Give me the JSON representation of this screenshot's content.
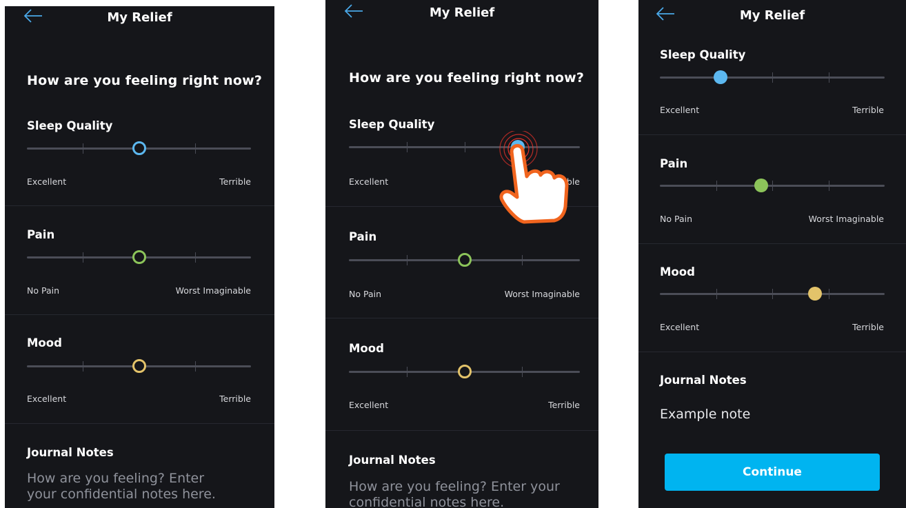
{
  "colors": {
    "background": "#15161a",
    "sleep_accent": "#5cb8f0",
    "pain_accent": "#8cc45a",
    "mood_accent": "#e3c36a",
    "continue_button": "#00b4f0",
    "tap_indicator": "#f0641e"
  },
  "icons": {
    "back": "arrow-left-icon",
    "tap": "tap-hand-icon"
  },
  "screens": [
    {
      "title": "My Relief",
      "question": "How are you feeling right now?",
      "sliders": [
        {
          "label": "Sleep Quality",
          "min_label": "Excellent",
          "max_label": "Terrible",
          "value_fraction": 0.5,
          "thumb_style": "outline"
        },
        {
          "label": "Pain",
          "min_label": "No Pain",
          "max_label": "Worst Imaginable",
          "value_fraction": 0.5,
          "thumb_style": "outline"
        },
        {
          "label": "Mood",
          "min_label": "Excellent",
          "max_label": "Terrible",
          "value_fraction": 0.5,
          "thumb_style": "outline"
        }
      ],
      "journal": {
        "label": "Journal Notes",
        "placeholder": "How are you feeling? Enter your confidential notes here.",
        "value": ""
      }
    },
    {
      "title": "My Relief",
      "question": "How are you feeling right now?",
      "sliders": [
        {
          "label": "Sleep Quality",
          "min_label": "Excellent",
          "max_label": "Terrible",
          "value_fraction": 0.73,
          "thumb_style": "filled"
        },
        {
          "label": "Pain",
          "min_label": "No Pain",
          "max_label": "Worst Imaginable",
          "value_fraction": 0.5,
          "thumb_style": "outline"
        },
        {
          "label": "Mood",
          "min_label": "Excellent",
          "max_label": "Terrible",
          "value_fraction": 0.5,
          "thumb_style": "outline"
        }
      ],
      "journal": {
        "label": "Journal Notes",
        "placeholder": "How are you feeling? Enter your confidential notes here.",
        "value": ""
      }
    },
    {
      "title": "My Relief",
      "sliders": [
        {
          "label": "Sleep Quality",
          "min_label": "Excellent",
          "max_label": "Terrible",
          "value_fraction": 0.27,
          "thumb_style": "filled"
        },
        {
          "label": "Pain",
          "min_label": "No Pain",
          "max_label": "Worst Imaginable",
          "value_fraction": 0.45,
          "thumb_style": "filled"
        },
        {
          "label": "Mood",
          "min_label": "Excellent",
          "max_label": "Terrible",
          "value_fraction": 0.69,
          "thumb_style": "filled"
        }
      ],
      "journal": {
        "label": "Journal Notes",
        "value": "Example note"
      },
      "continue_label": "Continue"
    }
  ]
}
